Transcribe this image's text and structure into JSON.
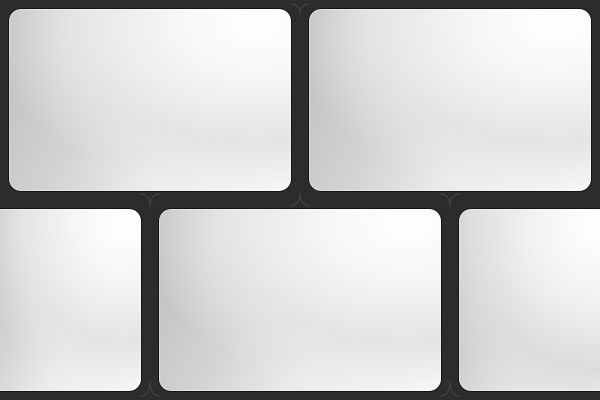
{
  "palette": {
    "background": "#2c2c2c",
    "tile_light": "#ffffff",
    "tile_dark": "#bdbdbd"
  },
  "tiles": [
    {
      "row": 1,
      "position": "left"
    },
    {
      "row": 1,
      "position": "right"
    },
    {
      "row": 2,
      "position": "left-partial"
    },
    {
      "row": 2,
      "position": "center"
    },
    {
      "row": 2,
      "position": "right-partial"
    }
  ]
}
